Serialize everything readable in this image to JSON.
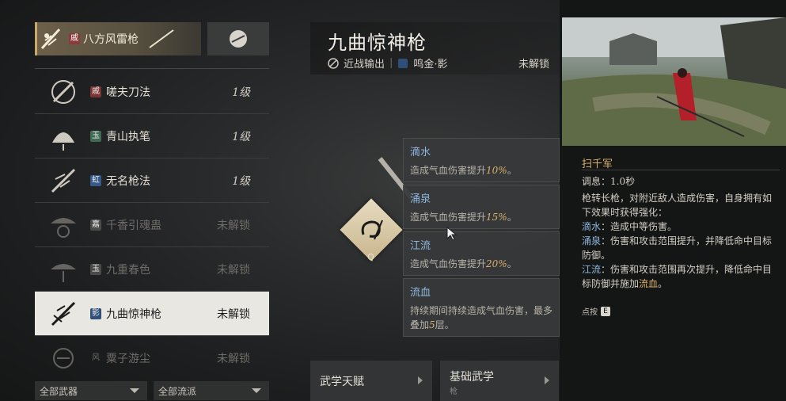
{
  "selected_weapon": {
    "tag": "戚",
    "label": "八方风雷枪"
  },
  "weapon_list": [
    {
      "tag": "戚",
      "name": "嗟夫刀法",
      "level": "1级",
      "locked": false,
      "selected": false
    },
    {
      "tag": "玉",
      "name": "青山执笔",
      "level": "1级",
      "locked": false,
      "selected": false
    },
    {
      "tag": "虹",
      "name": "无名枪法",
      "level": "1级",
      "locked": false,
      "selected": false
    },
    {
      "tag": "嘉",
      "name": "千香引魂蛊",
      "level": "未解锁",
      "locked": true,
      "selected": false
    },
    {
      "tag": "玉",
      "name": "九重春色",
      "level": "未解锁",
      "locked": true,
      "selected": false
    },
    {
      "tag": "影",
      "name": "九曲惊神枪",
      "level": "未解锁",
      "locked": false,
      "selected": true
    },
    {
      "tag": "风",
      "name": "粟子游尘",
      "level": "未解锁",
      "locked": true,
      "selected": false
    }
  ],
  "filters": {
    "weapon": "全部武器",
    "school": "全部流派"
  },
  "skill": {
    "title": "九曲惊神枪",
    "type": "近战输出",
    "school": "鸣金·影",
    "status": "未解锁",
    "hotkey": "Q"
  },
  "effects": [
    {
      "name": "滴水",
      "desc_pre": "造成气血伤害提升",
      "value": "10%",
      "desc_post": "。"
    },
    {
      "name": "涌泉",
      "desc_pre": "造成气血伤害提升",
      "value": "15%",
      "desc_post": "。"
    },
    {
      "name": "江流",
      "desc_pre": "造成气血伤害提升",
      "value": "20%",
      "desc_post": "。"
    },
    {
      "name": "流血",
      "desc_pre": "持续期间持续造成气血伤害，最多叠加",
      "value": "5",
      "desc_post": "层。"
    }
  ],
  "tabs": {
    "talent": "武学天赋",
    "basic": "基础武学",
    "basic_sub": "枪"
  },
  "detail": {
    "skill_name": "扫千军",
    "cooldown": "调息：1.0秒",
    "intro": "枪转长枪，对附近敌人造成伤害，自身拥有如下效果时获得强化：",
    "lines": [
      {
        "key": "滴水",
        "text": "：造成中等伤害。"
      },
      {
        "key": "涌泉",
        "text": "：伤害和攻击范围提升，并降低命中目标防御。"
      },
      {
        "key": "江流",
        "text": "：伤害和攻击范围再次提升，降低命中目标防御并施加",
        "extra": "流血",
        "end": "。"
      }
    ],
    "inspect": "点按",
    "inspect_key": "E"
  },
  "colors": {
    "accent_gold": "#d9b06a",
    "accent_blue": "#8fb8e0",
    "selected_bg": "#e9e7e2"
  }
}
